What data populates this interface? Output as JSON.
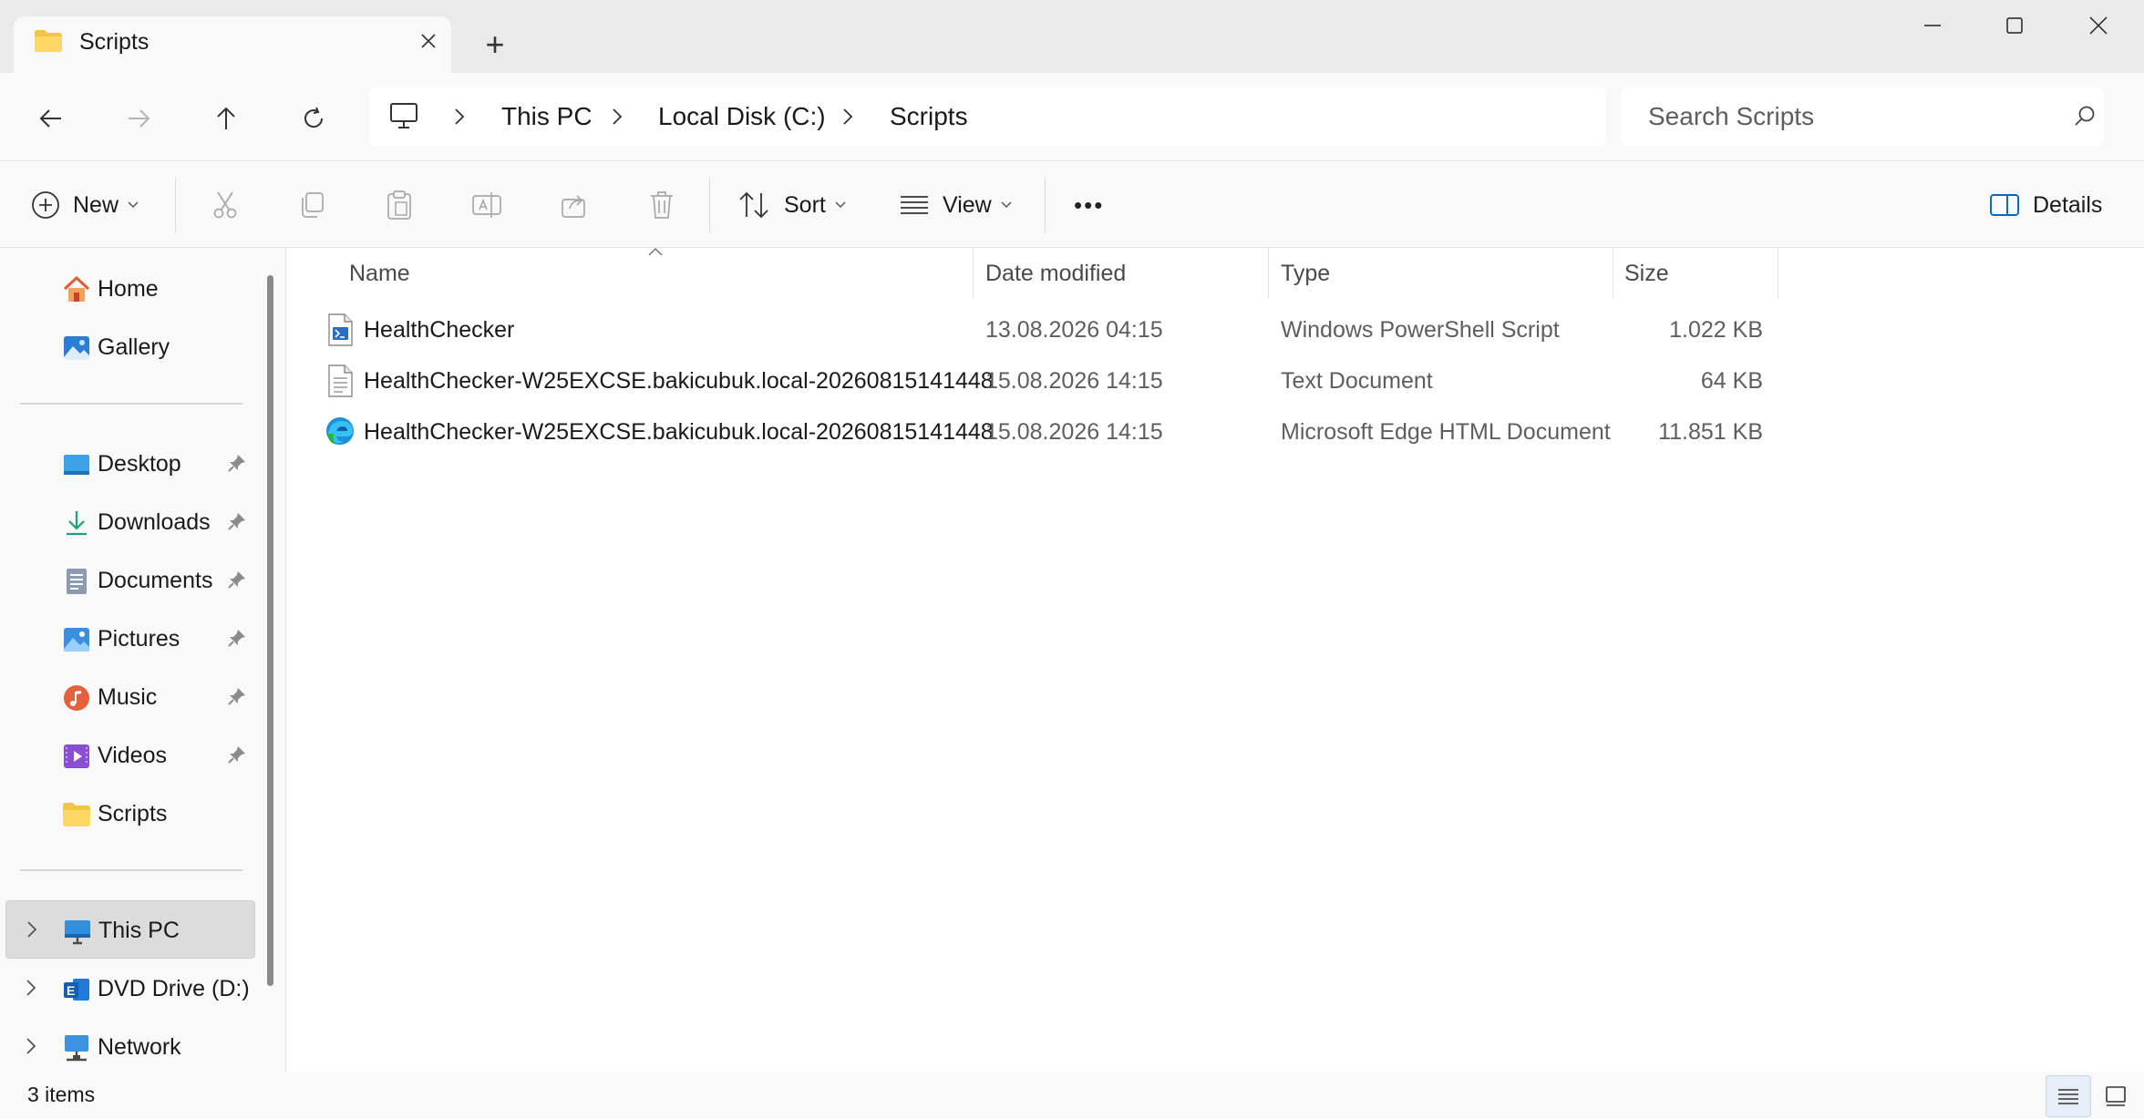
{
  "window": {
    "tab_title": "Scripts",
    "new_tab": "+",
    "tab_icon": "folder-icon"
  },
  "address": {
    "breadcrumbs": [
      "This PC",
      "Local Disk (C:)",
      "Scripts"
    ],
    "search_placeholder": "Search Scripts"
  },
  "commands": {
    "new_label": "New",
    "sort_label": "Sort",
    "view_label": "View",
    "more_label": "•••",
    "details_label": "Details"
  },
  "sidebar": {
    "quick": [
      {
        "label": "Home",
        "icon": "home-icon"
      },
      {
        "label": "Gallery",
        "icon": "gallery-icon"
      }
    ],
    "pinned": [
      {
        "label": "Desktop",
        "icon": "desktop-icon"
      },
      {
        "label": "Downloads",
        "icon": "downloads-icon"
      },
      {
        "label": "Documents",
        "icon": "documents-icon"
      },
      {
        "label": "Pictures",
        "icon": "pictures-icon"
      },
      {
        "label": "Music",
        "icon": "music-icon"
      },
      {
        "label": "Videos",
        "icon": "videos-icon"
      },
      {
        "label": "Scripts",
        "icon": "folder-icon"
      }
    ],
    "drives": [
      {
        "label": "This PC",
        "icon": "pc-icon",
        "selected": true
      },
      {
        "label": "DVD Drive (D:) E",
        "icon": "dvd-drive-icon"
      },
      {
        "label": "Network",
        "icon": "network-icon"
      }
    ]
  },
  "columns": {
    "name": "Name",
    "date": "Date modified",
    "type": "Type",
    "size": "Size"
  },
  "files": [
    {
      "name": "HealthChecker",
      "date": "13.08.2026 04:15",
      "type": "Windows PowerShell Script",
      "size": "1.022 KB",
      "icon": "powershell-script-icon"
    },
    {
      "name": "HealthChecker-W25EXCSE.bakicubuk.local-20260815141448",
      "date": "15.08.2026 14:15",
      "type": "Text Document",
      "size": "64 KB",
      "icon": "text-document-icon"
    },
    {
      "name": "HealthChecker-W25EXCSE.bakicubuk.local-20260815141448",
      "date": "15.08.2026 14:15",
      "type": "Microsoft Edge HTML Document",
      "size": "11.851 KB",
      "icon": "edge-html-icon"
    }
  ],
  "status": {
    "item_count": "3 items"
  },
  "colors": {
    "accent": "#0067c0",
    "folder": "#f4c542",
    "selected_bg": "#dcdcdc"
  }
}
